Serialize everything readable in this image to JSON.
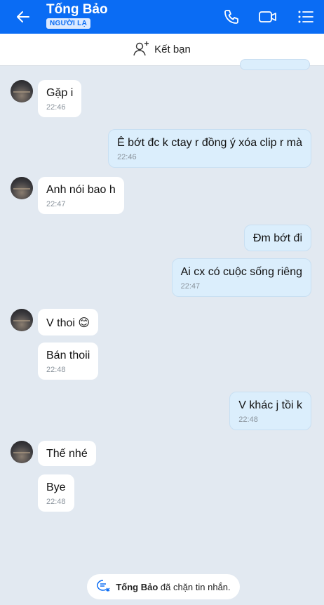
{
  "header": {
    "contact_name": "Tống Bảo",
    "badge": "NGƯỜI LẠ",
    "icons": [
      "back-arrow-icon",
      "phone-icon",
      "video-icon",
      "menu-list-icon"
    ]
  },
  "add_friend": {
    "label": "Kết bạn",
    "icon": "add-person-icon"
  },
  "messages": [
    {
      "dir": "in",
      "text": "Gặp i",
      "time": "22:46",
      "avatar": true
    },
    {
      "dir": "out",
      "text": "Ê bớt đc k ctay r đồng ý xóa clip r mà",
      "time": "22:46"
    },
    {
      "dir": "in",
      "text": "Anh nói bao h",
      "time": "22:47",
      "avatar": true
    },
    {
      "dir": "out",
      "text": "Đm bớt đi",
      "time": ""
    },
    {
      "dir": "out",
      "text": "Ai cx có cuộc sống riêng",
      "time": "22:47"
    },
    {
      "dir": "in",
      "text": "V thoi 😊",
      "time": "",
      "avatar": true
    },
    {
      "dir": "in",
      "text": "Bán thoii",
      "time": "22:48"
    },
    {
      "dir": "out",
      "text": "V khác j tồi k",
      "time": "22:48"
    },
    {
      "dir": "in",
      "text": "Thế nhé",
      "time": "",
      "avatar": true
    },
    {
      "dir": "in",
      "text": "Bye",
      "time": "22:48"
    }
  ],
  "blocked_notice": {
    "name": "Tống Bảo",
    "text": " đã chặn tin nhắn."
  },
  "colors": {
    "header_bg": "#0a6cf4",
    "outgoing_bubble": "#dbeefc",
    "incoming_bubble": "#ffffff",
    "chat_bg": "#e2e9f1"
  }
}
